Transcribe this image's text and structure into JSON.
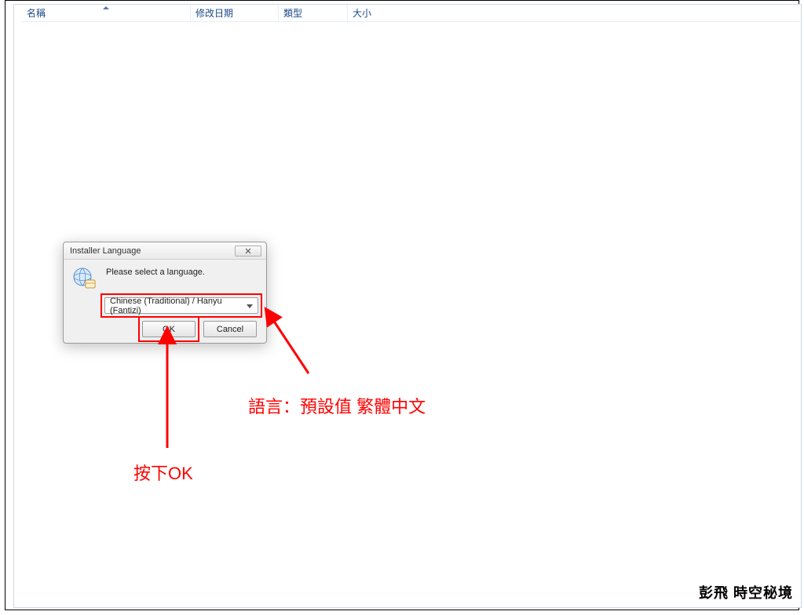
{
  "columns": {
    "name": "名稱",
    "date": "修改日期",
    "type": "類型",
    "size": "大小"
  },
  "dialog": {
    "title": "Installer Language",
    "prompt": "Please select a language.",
    "selected_language": "Chinese (Traditional) / Hanyu (Fantizi)",
    "ok_label": "OK",
    "cancel_label": "Cancel"
  },
  "annotations": {
    "language_label": "語言：預設值 繁體中文",
    "ok_label": "按下OK"
  },
  "watermark": "彭飛  時空秘境"
}
